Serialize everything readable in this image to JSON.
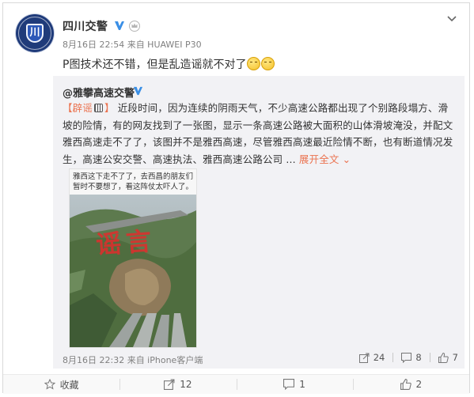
{
  "post": {
    "user": {
      "name": "四川交警",
      "verified": true
    },
    "meta": "8月16日 22:54 来自 HUAWEI P30",
    "text": "P图技术还不错，但是乱造谣就不对了"
  },
  "repost": {
    "user": "@雅攀高速交警",
    "tag": "【辟谣",
    "tag_close": "】",
    "body": "近段时间，因为连续的阴雨天气，不少高速公路都出现了个别路段塌方、滑坡的险情，有的网友找到了一张图，显示一条高速公路被大面积的山体滑坡淹没，并配文雅西高速走不了了，该图并不是雅西高速，尽管雅西高速最近险情不断，也有断道情况发生，高速公安交警、高速执法、雅西高速公路公司 ... ",
    "expand_label": "展开全文",
    "image": {
      "caption": "雅西这下走不了了，去西昌的朋友们暂时不要想了，看这阵仗太吓人了。",
      "stamp": "谣言"
    },
    "meta": "8月16日 22:32 来自 iPhone客户端",
    "actions": {
      "share": "24",
      "comment": "8",
      "like": "7"
    }
  },
  "bottom_bar": {
    "favorite": "收藏",
    "share": "12",
    "comment": "1",
    "like": "2"
  },
  "colors": {
    "accent": "#eb7350",
    "verified": "#3a8fe6",
    "emoji": "#f5c22a"
  }
}
